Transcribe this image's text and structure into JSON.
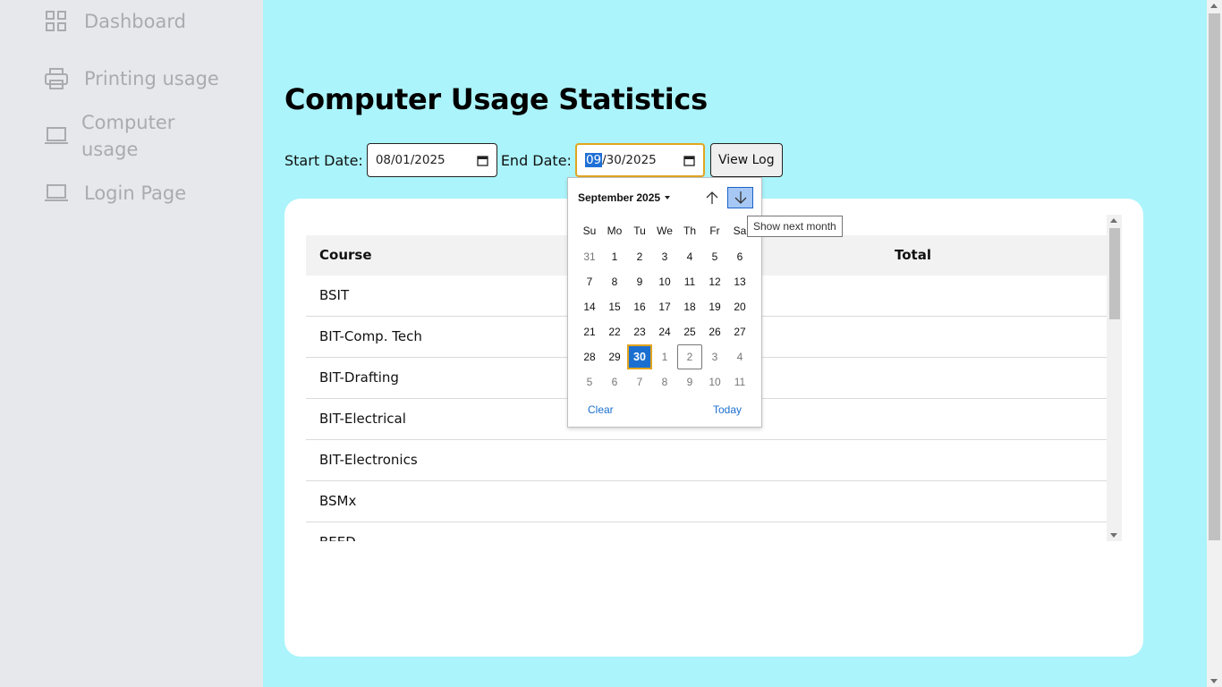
{
  "sidebar": {
    "items": [
      {
        "label": "Dashboard",
        "icon": "grid-icon"
      },
      {
        "label": "Printing usage",
        "icon": "printer-icon"
      },
      {
        "label": "Computer usage",
        "icon": "laptop-icon"
      },
      {
        "label": "Login Page",
        "icon": "laptop-icon"
      }
    ]
  },
  "main": {
    "title": "Computer Usage Statistics"
  },
  "filters": {
    "start_label": "Start Date:",
    "start_value": "08/01/2025",
    "end_label": "End Date:",
    "end_month": "09",
    "end_rest": "/30/2025",
    "view_button": "View Log"
  },
  "table": {
    "headers": [
      "Course",
      "Total"
    ],
    "rows": [
      "BSIT",
      "BIT-Comp. Tech",
      "BIT-Drafting",
      "BIT-Electrical",
      "BIT-Electronics",
      "BSMx",
      "BEED"
    ]
  },
  "calendar": {
    "month_label": "September 2025",
    "weekdays": [
      "Su",
      "Mo",
      "Tu",
      "We",
      "Th",
      "Fr",
      "Sa"
    ],
    "weeks": [
      [
        "31",
        "1",
        "2",
        "3",
        "4",
        "5",
        "6"
      ],
      [
        "7",
        "8",
        "9",
        "10",
        "11",
        "12",
        "13"
      ],
      [
        "14",
        "15",
        "16",
        "17",
        "18",
        "19",
        "20"
      ],
      [
        "21",
        "22",
        "23",
        "24",
        "25",
        "26",
        "27"
      ],
      [
        "28",
        "29",
        "30",
        "1",
        "2",
        "3",
        "4"
      ],
      [
        "5",
        "6",
        "7",
        "8",
        "9",
        "10",
        "11"
      ]
    ],
    "clear_label": "Clear",
    "today_label": "Today",
    "next_tooltip": "Show next month"
  },
  "colors": {
    "page_bg": "#abf4fb",
    "sidebar_bg": "#e6e8ec",
    "accent": "#1a6fd0",
    "focus": "#e2a51f"
  }
}
